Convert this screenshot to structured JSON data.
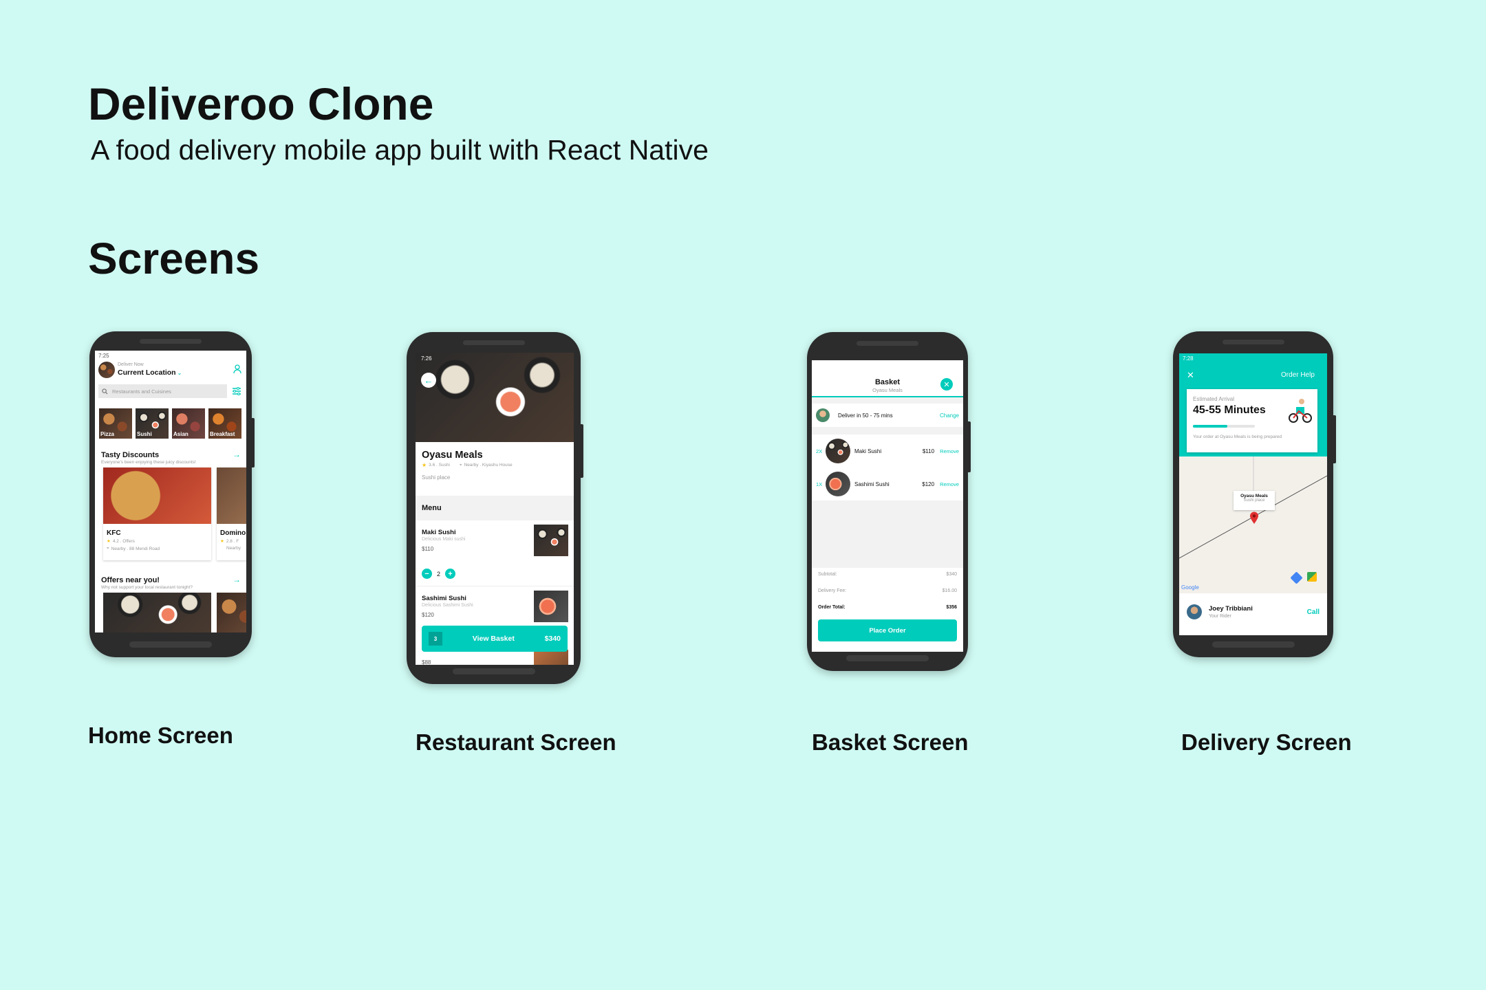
{
  "header": {
    "title": "Deliveroo Clone",
    "subtitle": "A food delivery mobile app built with React Native",
    "section": "Screens"
  },
  "captions": [
    "Home Screen",
    "Restaurant Screen",
    "Basket Screen",
    "Delivery Screen"
  ],
  "colors": {
    "accent": "#00ccbb",
    "background": "#cffaf3",
    "phone": "#2c2c2c"
  },
  "home": {
    "time": "7:25",
    "deliver_now": "Deliver Now",
    "location": "Current Location",
    "search_placeholder": "Restaurants and Cuisines",
    "categories": [
      "Pizza",
      "Sushi",
      "Asian",
      "Breakfast"
    ],
    "featured1_title": "Tasty Discounts",
    "featured1_desc": "Everyone's been enjoying these juicy discounts!",
    "card1_name": "KFC",
    "card1_rating": "4.2 . Offers",
    "card1_address": "Nearby . 88 Mendi Road",
    "card2_name": "Domino",
    "card2_rating": "2.8 . F",
    "card2_address": "Nearby",
    "featured2_title": "Offers near you!",
    "featured2_desc": "Why not support your local restaurant tonight?"
  },
  "restaurant": {
    "time": "7:26",
    "name": "Oyasu Meals",
    "rating": "3.6 . Sushi",
    "location": "Nearby . Kiyashu House",
    "description": "Sushi place",
    "menu_label": "Menu",
    "dish1_name": "Maki Sushi",
    "dish1_desc": "Delicious Maki sushi",
    "dish1_price": "$110",
    "dish1_qty": "2",
    "dish2_name": "Sashimi Sushi",
    "dish2_desc": "Delicious Sashimi Sushi",
    "dish2_price": "$120",
    "basket_count": "3",
    "basket_label": "View Basket",
    "basket_total": "$340",
    "dish3_price": "$88"
  },
  "basket": {
    "title": "Basket",
    "restaurant": "Oyasu Meals",
    "deliver_text": "Deliver in 50 - 75 mins",
    "change_label": "Change",
    "item1_qty": "2X",
    "item1_name": "Maki Sushi",
    "item1_price": "$110",
    "item2_qty": "1X",
    "item2_name": "Sashimi Sushi",
    "item2_price": "$120",
    "remove_label": "Remove",
    "subtotal_label": "Subtotal:",
    "subtotal_value": "$340",
    "fee_label": "Delivery Fee:",
    "fee_value": "$16.00",
    "total_label": "Order Total:",
    "total_value": "$356",
    "place_order": "Place Order"
  },
  "delivery": {
    "time": "7:28",
    "order_help": "Order Help",
    "eta_label": "Estimated Arrival",
    "eta_value": "45-55 Minutes",
    "progress": 0.55,
    "status_text": "Your order at Oyasu Meals is being prepared",
    "marker_title": "Oyasu Meals",
    "marker_sub": "Sushi place",
    "map_brand": "Google",
    "rider_name": "Joey Tribbiani",
    "rider_role": "Your Rider",
    "call_label": "Call"
  }
}
